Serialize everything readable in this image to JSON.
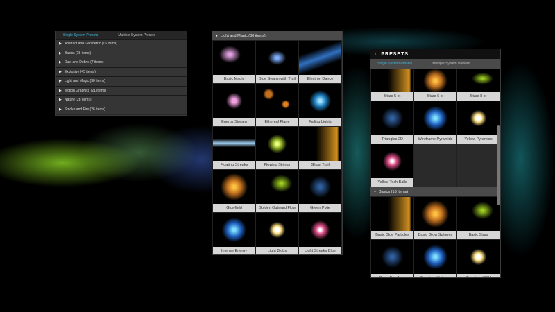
{
  "left_panel": {
    "tabs": [
      "Single System Presets",
      "Multiple System Presets"
    ],
    "categories": [
      "Abstract and Geometric (16 items)",
      "Basics (18 items)",
      "Dust and Debris (7 items)",
      "Explosive (45 items)",
      "Light and Magic (30 items)",
      "Motion Graphics (21 items)",
      "Nature (28 items)",
      "Smoke and Fire (26 items)"
    ]
  },
  "mid_panel": {
    "header": "Light and Magic (30 items)",
    "items": [
      "Basic Magic",
      "Blue Swarm with Trail",
      "Electron Dance",
      "Energy Stream",
      "Ethereal Plane",
      "Falling Lights",
      "Floating Streaks",
      "Flowing Strings",
      "Ghost Trail",
      "Glowfield",
      "Golden Outward Flow",
      "Green Pixie",
      "Intense Energy",
      "Light Blobs",
      "Light Streaks Blue"
    ]
  },
  "right_panel": {
    "title": "PRESETS",
    "back": "‹",
    "tabs": [
      "Single System Presets",
      "Multiple System Presets"
    ],
    "items_a": [
      "Stars 5 pt",
      "Stars 6 pt",
      "Stars 8 pt",
      "Triangles 2D",
      "Wireframe Pyramids",
      "Yellow Pyramids",
      "Yellow Tech Balls"
    ],
    "section": "Basics (18 items)",
    "items_b": [
      "Basic Blue Particles",
      "Basic Glow Spheres",
      "Basic Stars",
      "Deep Box Area",
      "Directional Intense",
      "Directional Mild"
    ]
  },
  "colors": {
    "accent": "#3db9e0"
  }
}
